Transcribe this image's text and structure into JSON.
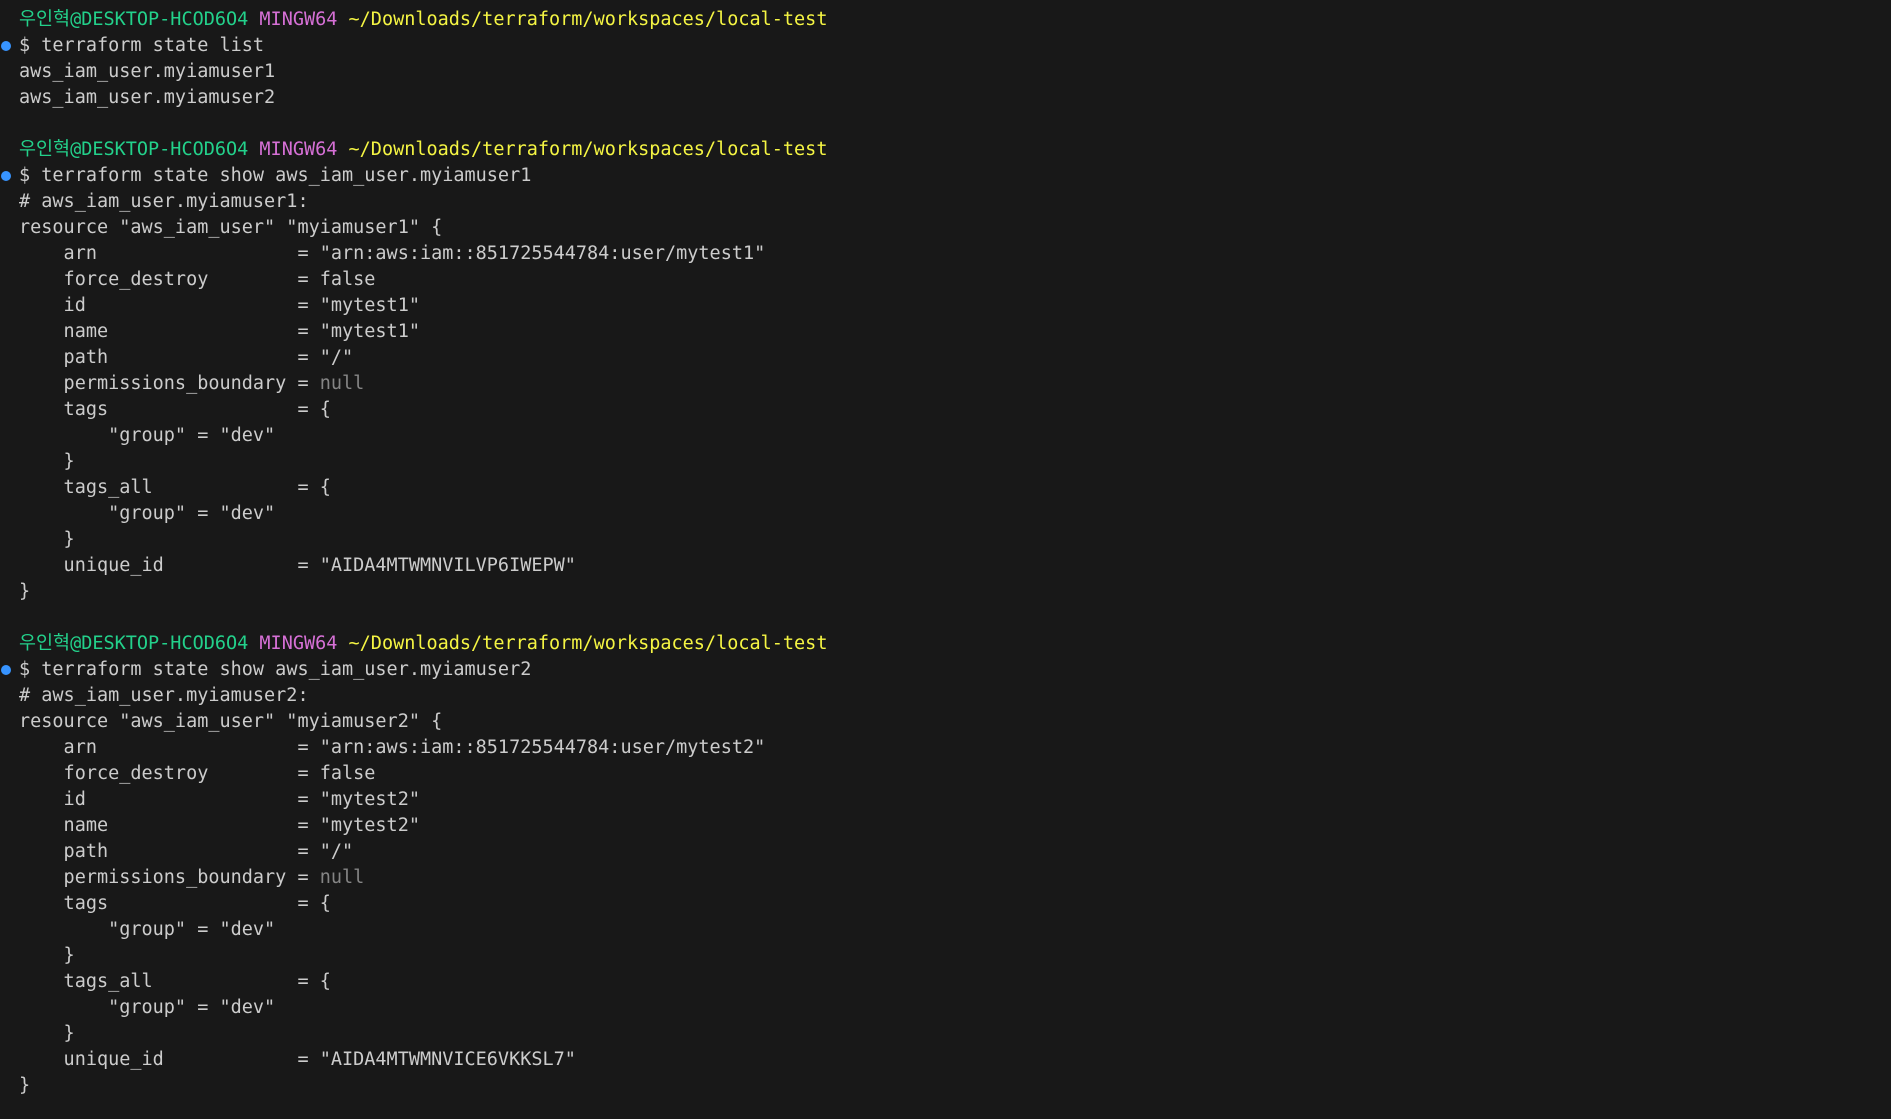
{
  "colors": {
    "background": "#181818",
    "text": "#cccccc",
    "prompt_user": "#23d18b",
    "prompt_system": "#d670d6",
    "prompt_path": "#f5f543",
    "null_value": "#858585",
    "command_marker": "#3794ff"
  },
  "prompt": {
    "user": "우인혁",
    "host": "@DESKTOP-HCOD6O4",
    "system": "MINGW64",
    "path": "~/Downloads/terraform/workspaces/local-test",
    "symbol": "$"
  },
  "blocks": [
    {
      "command": "terraform state list",
      "output": [
        "aws_iam_user.myiamuser1",
        "aws_iam_user.myiamuser2"
      ]
    },
    {
      "command": "terraform state show aws_iam_user.myiamuser1",
      "comment": "# aws_iam_user.myiamuser1:",
      "resource_open": "resource \"aws_iam_user\" \"myiamuser1\" {",
      "attrs": {
        "arn": "    arn                  = \"arn:aws:iam::851725544784:user/mytest1\"",
        "force_destroy": "    force_destroy        = false",
        "id": "    id                   = \"mytest1\"",
        "name": "    name                 = \"mytest1\"",
        "path": "    path                 = \"/\"",
        "permissions_boundary_key": "    permissions_boundary = ",
        "permissions_boundary_val": "null",
        "tags": "    tags                 = {",
        "tags_group": "        \"group\" = \"dev\"",
        "tags_close": "    }",
        "tags_all": "    tags_all             = {",
        "tags_all_group": "        \"group\" = \"dev\"",
        "tags_all_close": "    }",
        "unique_id": "    unique_id            = \"AIDA4MTWMNVILVP6IWEPW\""
      },
      "resource_close": "}"
    },
    {
      "command": "terraform state show aws_iam_user.myiamuser2",
      "comment": "# aws_iam_user.myiamuser2:",
      "resource_open": "resource \"aws_iam_user\" \"myiamuser2\" {",
      "attrs": {
        "arn": "    arn                  = \"arn:aws:iam::851725544784:user/mytest2\"",
        "force_destroy": "    force_destroy        = false",
        "id": "    id                   = \"mytest2\"",
        "name": "    name                 = \"mytest2\"",
        "path": "    path                 = \"/\"",
        "permissions_boundary_key": "    permissions_boundary = ",
        "permissions_boundary_val": "null",
        "tags": "    tags                 = {",
        "tags_group": "        \"group\" = \"dev\"",
        "tags_close": "    }",
        "tags_all": "    tags_all             = {",
        "tags_all_group": "        \"group\" = \"dev\"",
        "tags_all_close": "    }",
        "unique_id": "    unique_id            = \"AIDA4MTWMNVICE6VKKSL7\""
      },
      "resource_close": "}"
    }
  ]
}
